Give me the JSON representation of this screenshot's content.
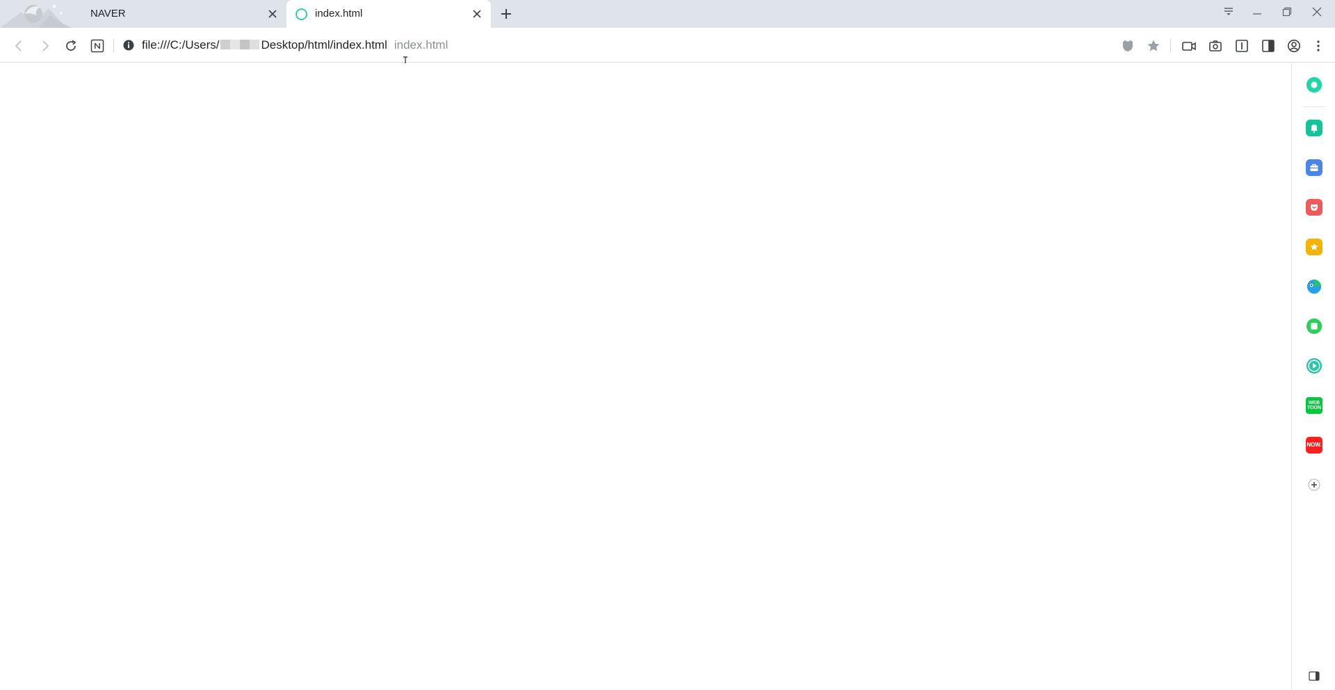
{
  "tabs": [
    {
      "title": "NAVER",
      "active": false
    },
    {
      "title": "index.html",
      "active": true
    }
  ],
  "addressbar": {
    "url_prefix": "file:///C:/Users/",
    "url_suffix": "Desktop/html/index.html",
    "page_title_hint": "index.html"
  },
  "icons": {
    "back": "arrow-left-icon",
    "forward": "arrow-right-icon",
    "reload": "reload-icon",
    "naver_home": "naver-n-icon",
    "site_info": "info-icon",
    "shield": "shield-icon",
    "bookmark": "star-icon",
    "video": "video-icon",
    "capture": "camera-icon",
    "reader": "reader-icon",
    "split": "split-view-icon",
    "profile": "profile-icon",
    "menu": "more-vert-icon"
  },
  "sidebar": {
    "items": [
      {
        "name": "whale-home",
        "color": "#1fd6a6"
      },
      {
        "name": "notifications",
        "color": "#14c59a"
      },
      {
        "name": "tools",
        "color": "#4a86ea"
      },
      {
        "name": "pocket",
        "color": "#ef5a5a"
      },
      {
        "name": "favorites",
        "color": "#f4b400"
      },
      {
        "name": "papago",
        "color": "#27a0e6"
      },
      {
        "name": "memo",
        "color": "#2ccf5a"
      },
      {
        "name": "player",
        "color": "#29c7a6"
      },
      {
        "name": "webtoon",
        "color": "#00c73c",
        "label": "WEB TOON"
      },
      {
        "name": "now",
        "color": "#ff1f1f",
        "label": "NOW."
      }
    ],
    "add_label": "+"
  },
  "colors": {
    "tabbar_bg": "#dfe3ea",
    "accent": "#35cfa6"
  }
}
